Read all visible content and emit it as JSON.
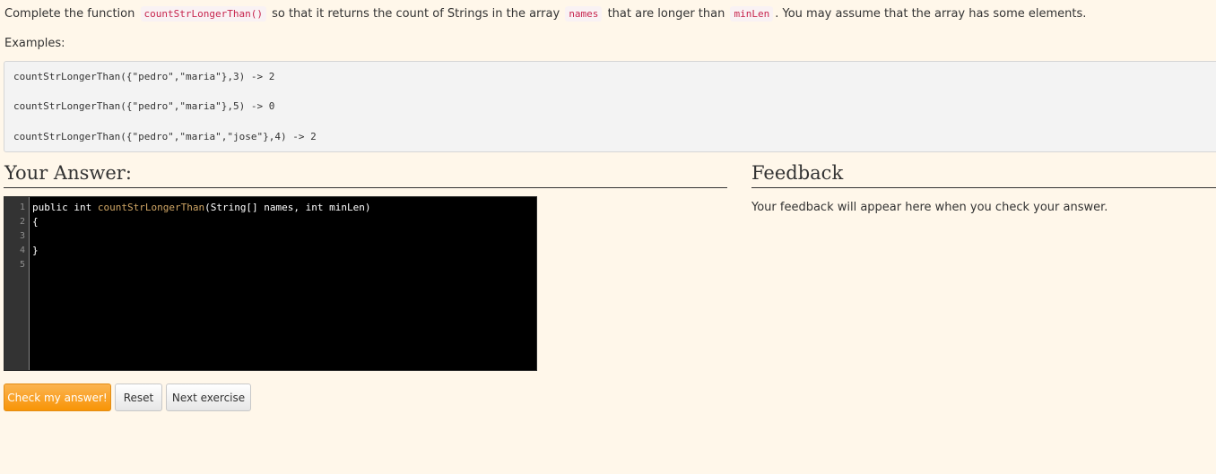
{
  "prompt": {
    "part1": "Complete the function",
    "code1": "countStrLongerThan()",
    "part2": "so that it returns the count of Strings in the array",
    "code2": "names",
    "part3": "that are longer than",
    "code3": "minLen",
    "part4": ". You may assume that the array has some elements."
  },
  "examples": {
    "label": "Examples:",
    "lines": [
      "countStrLongerThan({\"pedro\",\"maria\"},3) -> 2",
      "countStrLongerThan({\"pedro\",\"maria\"},5) -> 0",
      "countStrLongerThan({\"pedro\",\"maria\",\"jose\"},4) -> 2"
    ]
  },
  "answer": {
    "title": "Your Answer:"
  },
  "feedback": {
    "title": "Feedback",
    "message": "Your feedback will appear here when you check your answer."
  },
  "editor": {
    "line_numbers": [
      "1",
      "2",
      "3",
      "4",
      "5"
    ],
    "line1": {
      "prefix": "public int ",
      "fn": "countStrLongerThan",
      "suffix": "(String[] names, int minLen)"
    },
    "line2": "{",
    "line3": "",
    "line4": "}",
    "line5": "",
    "colors": {
      "background": "#000000",
      "gutter": "#333333",
      "function_name": "#d1a766"
    }
  },
  "buttons": {
    "check": "Check my answer!",
    "reset": "Reset",
    "next": "Next exercise"
  },
  "colors": {
    "page_background": "#fff7ea",
    "inline_code": "#c7254e",
    "primary_button": "#f89406"
  }
}
